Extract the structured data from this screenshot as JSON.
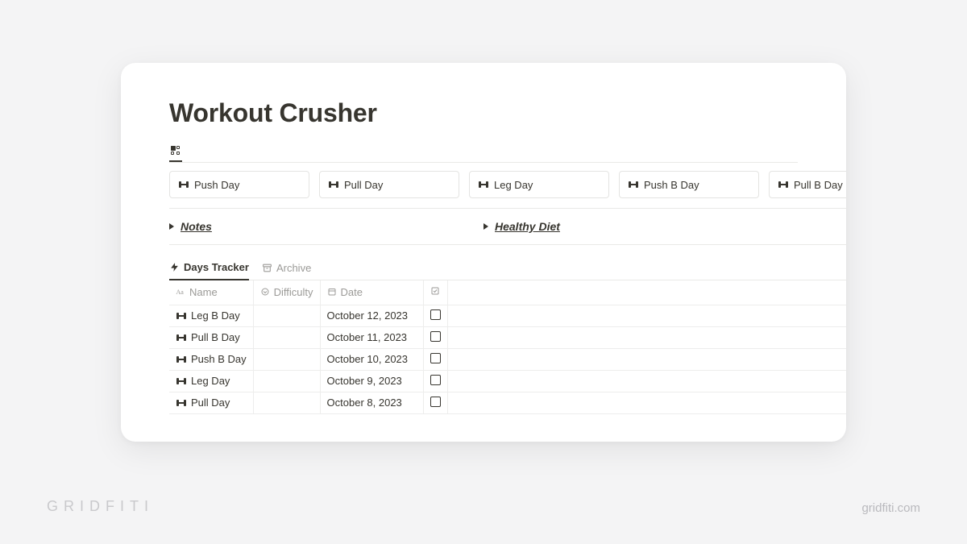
{
  "page": {
    "title": "Workout Crusher"
  },
  "gallery": {
    "items": [
      {
        "label": "Push Day"
      },
      {
        "label": "Pull Day"
      },
      {
        "label": "Leg Day"
      },
      {
        "label": "Push B Day"
      },
      {
        "label": "Pull B Day"
      }
    ]
  },
  "toggles": {
    "left": "Notes",
    "right": "Healthy Diet"
  },
  "db": {
    "tabs": {
      "active": "Days Tracker",
      "archive": "Archive"
    },
    "columns": {
      "name": "Name",
      "difficulty": "Difficulty",
      "date": "Date"
    },
    "rows": [
      {
        "name": "Leg B Day",
        "difficulty": "",
        "date": "October 12, 2023",
        "checked": false
      },
      {
        "name": "Pull B Day",
        "difficulty": "",
        "date": "October 11, 2023",
        "checked": false
      },
      {
        "name": "Push B Day",
        "difficulty": "",
        "date": "October 10, 2023",
        "checked": false
      },
      {
        "name": "Leg Day",
        "difficulty": "",
        "date": "October 9, 2023",
        "checked": false
      },
      {
        "name": "Pull Day",
        "difficulty": "",
        "date": "October 8, 2023",
        "checked": false
      }
    ]
  },
  "watermark": {
    "left": "GRIDFITI",
    "right": "gridfiti.com"
  }
}
